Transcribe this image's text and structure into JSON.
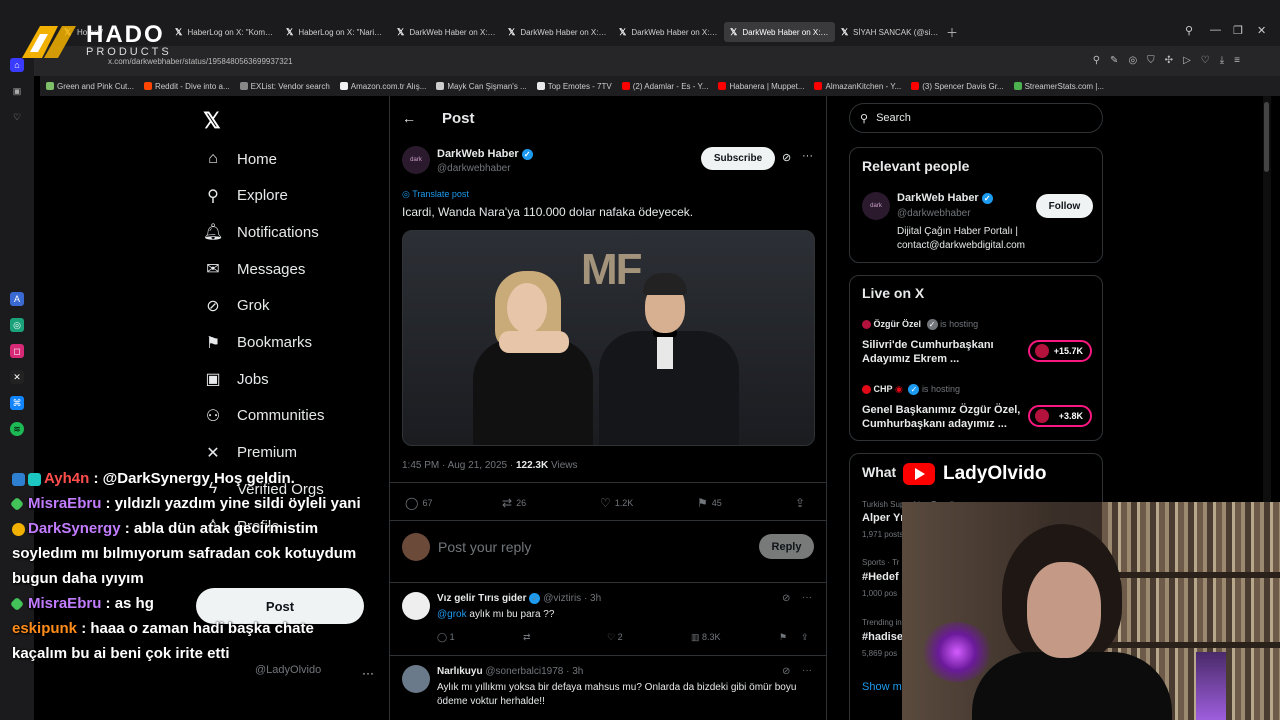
{
  "browser": {
    "tabs": [
      {
        "label": "Home /",
        "active": false
      },
      {
        "label": "HaberLog on X: \"Komisyo",
        "active": false
      },
      {
        "label": "HaberLog on X: \"Narin Gü",
        "active": false
      },
      {
        "label": "DarkWeb Haber on X: \"Ad",
        "active": false
      },
      {
        "label": "DarkWeb Haber on X: \"Ün",
        "active": false
      },
      {
        "label": "DarkWeb Haber on X: \"7 y",
        "active": false
      },
      {
        "label": "DarkWeb Haber on X: \"Ica",
        "active": true
      },
      {
        "label": "SİYAH SANCAK (@siyahsa",
        "active": false
      }
    ],
    "url": "x.com/darkwebhaber/status/1958480563699937321",
    "bookmarks": [
      {
        "label": "Green and Pink Cut...",
        "color": "#7fbf6a"
      },
      {
        "label": "Reddit - Dive into a...",
        "color": "#ff4500"
      },
      {
        "label": "EXList: Vendor search",
        "color": "#888888"
      },
      {
        "label": "Amazon.com.tr Alış...",
        "color": "#f2f2f2"
      },
      {
        "label": "Mayk Can Şişman's ...",
        "color": "#cccccc"
      },
      {
        "label": "Top Emotes - 7TV",
        "color": "#e7e9ea"
      },
      {
        "label": "(2) Adamlar - Es - Y...",
        "color": "#ff0000"
      },
      {
        "label": "Habanera | Muppet...",
        "color": "#ff0000"
      },
      {
        "label": "AlmazanKitchen - Y...",
        "color": "#ff0000"
      },
      {
        "label": "(3) Spencer Davis Gr...",
        "color": "#ff0000"
      },
      {
        "label": "StreamerStats.com |...",
        "color": "#4caf50"
      }
    ]
  },
  "logo": {
    "name": "HADO",
    "sub": "PRODUCTS"
  },
  "nav": {
    "items": [
      {
        "label": "Home",
        "icon": "home-icon",
        "glyph": "⌂"
      },
      {
        "label": "Explore",
        "icon": "search-icon",
        "glyph": "⚲"
      },
      {
        "label": "Notifications",
        "icon": "bell-icon",
        "glyph": "🔔︎"
      },
      {
        "label": "Messages",
        "icon": "mail-icon",
        "glyph": "✉"
      },
      {
        "label": "Grok",
        "icon": "grok-icon",
        "glyph": "⊘"
      },
      {
        "label": "Bookmarks",
        "icon": "bookmark-icon",
        "glyph": "⚑"
      },
      {
        "label": "Jobs",
        "icon": "briefcase-icon",
        "glyph": "▣"
      },
      {
        "label": "Communities",
        "icon": "people-icon",
        "glyph": "⚇"
      },
      {
        "label": "Premium",
        "icon": "x-icon",
        "glyph": "✕"
      },
      {
        "label": "Verified Orgs",
        "icon": "lightning-icon",
        "glyph": "ϟ"
      },
      {
        "label": "Profile",
        "icon": "person-icon",
        "glyph": "♙"
      }
    ],
    "post_label": "Post",
    "me_handle": "@LadyOlvido"
  },
  "post": {
    "header_title": "Post",
    "author_name": "DarkWeb Haber",
    "author_handle": "@darkwebhaber",
    "subscribe_label": "Subscribe",
    "translate_label": "Translate post",
    "text": "Icardi, Wanda Nara'ya 110.000 dolar nafaka ödeyecek.",
    "media_text": "MF",
    "time": "1:45 PM · Aug 21, 2025 · ",
    "views_count": "122.3K",
    "views_label": " Views",
    "stats": {
      "replies": "67",
      "reposts": "26",
      "likes": "1.2K",
      "bookmarks": "45"
    },
    "reply_placeholder": "Post your reply",
    "reply_button": "Reply"
  },
  "comments": [
    {
      "name": "Vız gelir Tırıs gider",
      "meta": "@viztiris · 3h",
      "mention": "@grok",
      "text": " aylık mı bu para ??",
      "replies": "1",
      "likes": "2",
      "views": "8.3K"
    },
    {
      "name": "Narlıkuyu",
      "meta": "@sonerbalci1978 · 3h",
      "mention": "",
      "text": "Aylık mı yıllıkmı yoksa bir defaya mahsus mu? Onlarda da bizdeki gibi ömür boyu ödeme voktur herhalde!!"
    }
  ],
  "right": {
    "search_placeholder": "Search",
    "relevant_title": "Relevant people",
    "person_name": "DarkWeb Haber",
    "person_handle": "@darkwebhaber",
    "person_bio": "Dijital Çağın Haber Portalı | contact@darkwebdigital.com",
    "follow_label": "Follow",
    "live_title": "Live on X",
    "live": [
      {
        "host": "Özgür Özel",
        "status": "is hosting",
        "title": "Silivri'de Cumhurbaşkanı Adayımız Ekrem ...",
        "count": "+15.7K"
      },
      {
        "host": "CHP",
        "status": "is hosting",
        "title": "Genel Başkanımız Özgür Özel, Cumhurbaşkanı adayımız ...",
        "count": "+3.8K"
      }
    ],
    "trends_title": "What",
    "trends": [
      {
        "category": "Turkish Super Lig · Trending",
        "name": "Alper Yı",
        "count": "1,971 posts"
      },
      {
        "category": "Sports · Tr",
        "name": "#Hedef",
        "count": "1,000 pos"
      },
      {
        "category": "Trending in",
        "name": "#hadise",
        "count": "5,869 pos"
      }
    ],
    "show_more": "Show m"
  },
  "stream": {
    "channel": "LadyOlvido",
    "chat": [
      {
        "user": "Ayh4n",
        "color": "#ff4d4d",
        "msg": ": @DarkSynergy Hoş geldin.",
        "badge": "b"
      },
      {
        "user": "MisraEbru",
        "color": "#c27cff",
        "msg": ": yıldızlı yazdım yine sildi öyleli yani",
        "badge": "g"
      },
      {
        "user": "DarkSynergy",
        "color": "#c27cff",
        "msg": ": abla dün atak gecirmistim soyledım mı bılmıyorum safradan cok kotuydum bugun daha ıyıyım",
        "badge": "y"
      },
      {
        "user": "MisraEbru",
        "color": "#c27cff",
        "msg": ": as hg",
        "badge": "g"
      },
      {
        "user": "eskipunk",
        "color": "#ff8c1a",
        "msg": ": haaa o zaman hadi başka chate kaçalım bu ai beni çok irite etti",
        "badge": ""
      }
    ]
  },
  "colors": {
    "accent": "#1d9bf0",
    "background": "#000000",
    "live": "#f91880"
  }
}
